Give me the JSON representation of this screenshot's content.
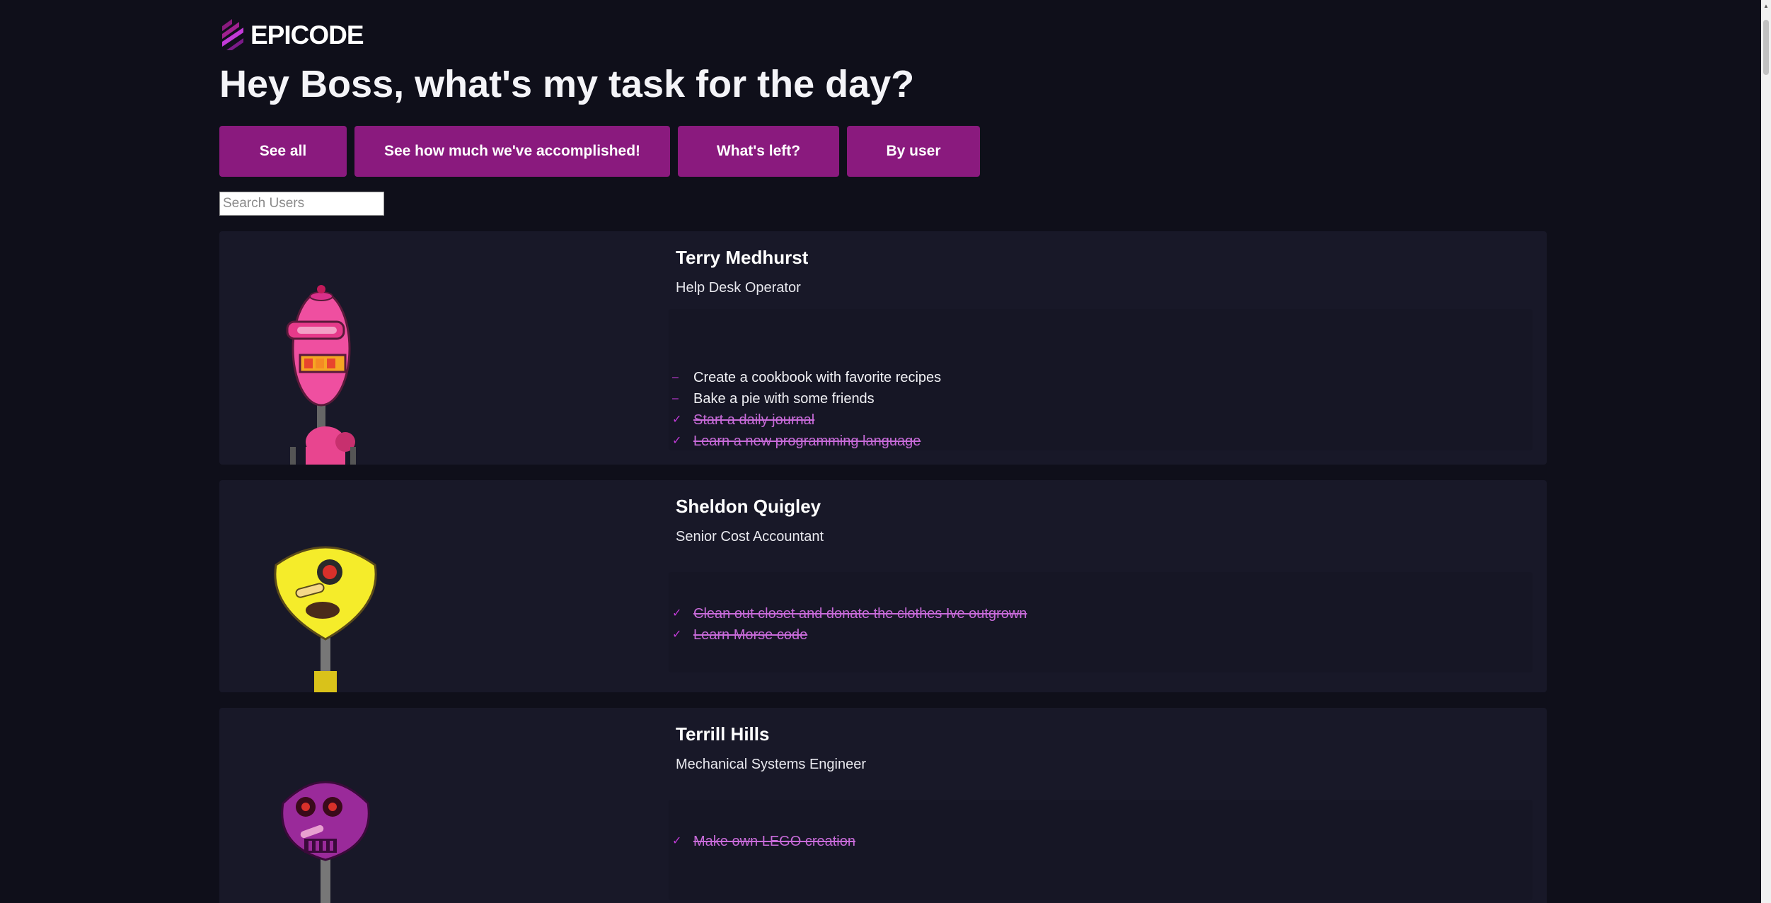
{
  "brand": {
    "logo_text": "EPICODE",
    "accent": "#8a1a7e"
  },
  "header": {
    "title": "Hey Boss, what's my task for the day?"
  },
  "filters": [
    {
      "label": "See all"
    },
    {
      "label": "See how much we've accomplished!"
    },
    {
      "label": "What's left?"
    },
    {
      "label": "By user"
    }
  ],
  "search": {
    "placeholder": "Search Users",
    "value": ""
  },
  "users": [
    {
      "name": "Terry Medhurst",
      "job": "Help Desk Operator",
      "avatar": "pink-robot",
      "tasks": [
        {
          "text": "Create a cookbook with favorite recipes",
          "done": false
        },
        {
          "text": "Bake a pie with some friends",
          "done": false
        },
        {
          "text": "Start a daily journal",
          "done": true
        },
        {
          "text": "Learn a new programming language",
          "done": true
        }
      ]
    },
    {
      "name": "Sheldon Quigley",
      "job": "Senior Cost Accountant",
      "avatar": "yellow-robot",
      "tasks": [
        {
          "text": "Clean out closet and donate the clothes Ive outgrown",
          "done": true
        },
        {
          "text": "Learn Morse code",
          "done": true
        }
      ]
    },
    {
      "name": "Terrill Hills",
      "job": "Mechanical Systems Engineer",
      "avatar": "purple-robot",
      "tasks": [
        {
          "text": "Make own LEGO creation",
          "done": true
        }
      ]
    }
  ],
  "icons": {
    "todo": "dash-icon",
    "done": "check-icon"
  }
}
